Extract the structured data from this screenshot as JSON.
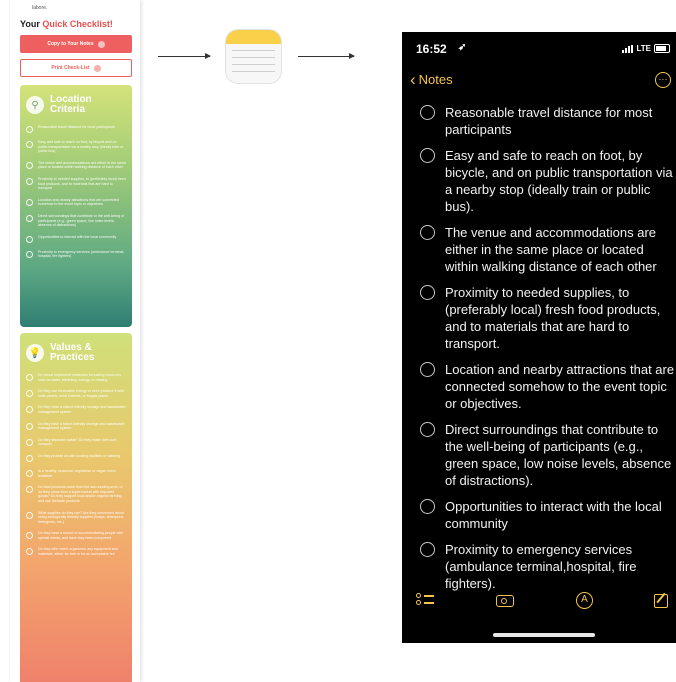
{
  "web": {
    "top_text": "labore.",
    "heading_prefix": "Your ",
    "heading_accent": "Quick Checklist",
    "heading_suffix": "!",
    "copy_button": "Copy to Your Notes",
    "print_button": "Print Check-List",
    "location_title_line1": "Location",
    "location_title_line2": "Criteria",
    "values_title_line1": "Values &",
    "values_title_line2": "Practices",
    "location_items": [
      "Reasonable travel distance for most participants",
      "Easy and safe to reach on foot, by bicycle and on public transportation via a nearby stop (ideally train or public bus)",
      "The venue and accommodations are either in the same place or located within walking distance of each other",
      "Proximity to needed supplies, to (preferably local) fresh food products, and to materials that are hard to transport",
      "Location and nearby attractions that are connected somehow to the event topic or objectives",
      "Direct surroundings that contribute to the well-being of participants (e.g., green space, low noise levels, absence of distractions)",
      "Opportunities to interact with the local community",
      "Proximity to emergency services (ambulance terminal, hospital, fire fighters)"
    ],
    "values_items": [
      "Do venue implement measures for saving resources such as water, electricity, energy, or heating",
      "Do they use renewable energy or even produce it with solar panels, wind turbines, or biogas plants",
      "Do they have a nature-friendly sewage and wastewater management system",
      "Do they have a future-friendly sewage and wastewater management system",
      "Do they separate waste? Do they make their own compost",
      "Do they provide on-site cooking facilities or catering",
      "Is a healthy, seasonal, vegetarian or vegan menu available",
      "Do food products come from the surrounding area, or do they come from a supermarket with imported goods? Do they support local and/or organic farming and use fairtrade products",
      "What supplies do they use? Are they concerned about using ecologically friendly supplies (soaps, shampoos, detergents, etc.)",
      "Do they have a record of accommodating people with special needs, and have they been competent",
      "Do they offer event organizers any equipment and materials, either for free or for an acceptable fee"
    ]
  },
  "phone": {
    "time": "16:52",
    "location_arrow": "➶",
    "network": "LTE",
    "back_label": "Notes",
    "more_icon": "···",
    "items": [
      "Reasonable travel distance for most participants",
      "Easy and safe to reach on foot, by bicycle, and on public transportation via a nearby stop (ideally train or public bus).",
      "The venue and accommodations are either in the same place or located within walking distance of each other",
      "Proximity to needed supplies, to (preferably local) fresh food products, and to materials that are hard to transport.",
      "Location and nearby attractions that are connected somehow to the event topic or objectives.",
      "Direct surroundings that contribute to the well-being of participants (e.g., green space, low noise levels, absence of distractions).",
      "Opportunities to interact with the local community",
      "Proximity to emergency services (ambulance terminal,hospital, fire fighters)."
    ],
    "toolbar_icons": [
      "checklist-icon",
      "camera-icon",
      "markup-icon",
      "compose-icon"
    ]
  },
  "colors": {
    "accent_red": "#ee5f5f",
    "notes_yellow": "#f5c54a",
    "phone_bg": "#000000"
  }
}
